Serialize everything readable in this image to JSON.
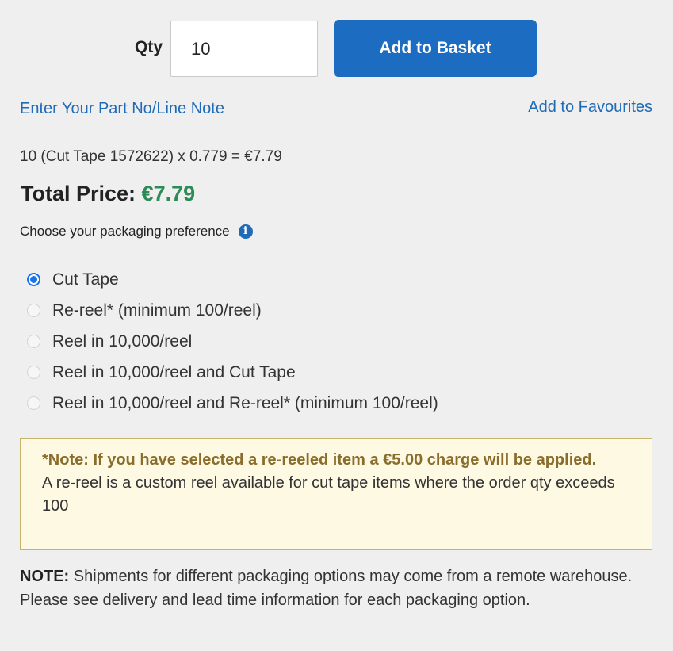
{
  "qty": {
    "label": "Qty",
    "value": "10"
  },
  "add_to_basket_label": "Add to Basket",
  "part_note_link": "Enter Your Part No/Line Note",
  "favourites_link": "Add to Favourites",
  "calculation": "10 (Cut Tape 1572622) x 0.779 = €7.79",
  "total": {
    "label": "Total Price:",
    "amount": "€7.79",
    "amount_color": "#2e8b57"
  },
  "packaging": {
    "prompt": "Choose your packaging preference",
    "info_icon": "info-icon",
    "selected_index": 0,
    "options": [
      {
        "label": "Cut Tape",
        "checked": true
      },
      {
        "label": "Re-reel* (minimum 100/reel)",
        "checked": false
      },
      {
        "label": "Reel in 10,000/reel",
        "checked": false
      },
      {
        "label": "Reel in 10,000/reel and Cut Tape",
        "checked": false
      },
      {
        "label": "Reel in 10,000/reel and Re-reel* (minimum 100/reel)",
        "checked": false
      }
    ]
  },
  "reel_note": {
    "bold": "*Note: If you have selected a re-reeled item a €5.00 charge will be applied.",
    "text": "A re-reel is a custom reel available for cut tape items where the order qty exceeds 100"
  },
  "shipment_note": {
    "label": "NOTE:",
    "text": "Shipments for different packaging options may come from a remote warehouse. Please see delivery and lead time information for each packaging option."
  },
  "colors": {
    "button": "#1c6dc1",
    "link": "#1f6bb8",
    "note_background": "#fdf9e3",
    "note_border": "#c9b26a"
  }
}
